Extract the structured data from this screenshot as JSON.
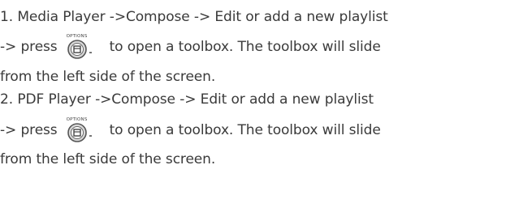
{
  "paragraphs": [
    {
      "number": "1.",
      "line1": "Media Player ->Compose -> Edit or add a new playlist",
      "line2_before": "-> press",
      "line2_after": "to open a toolbox. The toolbox will slide",
      "line3": "from the left side of the screen."
    },
    {
      "number": "2.",
      "line1": "PDF Player ->Compose -> Edit or add a new playlist",
      "line2_before": "-> press",
      "line2_after": "to open a toolbox. The toolbox will slide",
      "line3": "from the left side of the screen."
    }
  ],
  "icon": {
    "name": "options-button-icon",
    "caption": "OPTIONS"
  },
  "colors": {
    "text": "#3a3a3a",
    "icon_fill": "#d8d8d8",
    "icon_stroke": "#555555"
  }
}
